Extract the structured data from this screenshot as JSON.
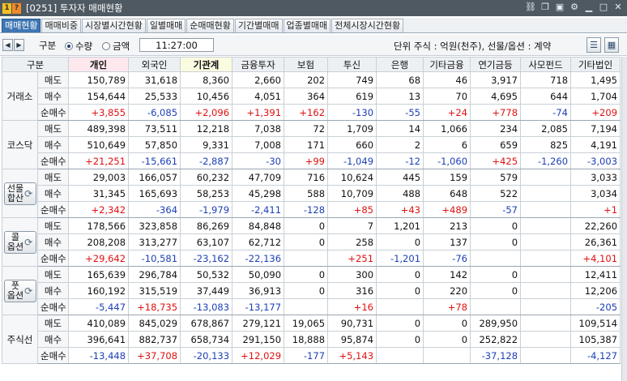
{
  "window": {
    "badge1": "1",
    "badge2": "?",
    "title": "[0251] 투자자 매매현황",
    "icons": [
      "link-icon",
      "copy-icon",
      "camera-icon",
      "gear-icon",
      "minimize-icon",
      "maximize-icon",
      "close-icon"
    ]
  },
  "tabs": [
    {
      "label": "매매현황",
      "active": true
    },
    {
      "label": "매매비중"
    },
    {
      "label": "시장별시간현황"
    },
    {
      "label": "일별매매"
    },
    {
      "label": "순매매현황"
    },
    {
      "label": "기간별매매"
    },
    {
      "label": "업종별매매"
    },
    {
      "label": "전체시장시간현황"
    }
  ],
  "controls": {
    "type_label": "구분",
    "radio_quantity": "수량",
    "radio_amount": "금액",
    "selected": "수량",
    "time": "11:27:00",
    "unit_text": "단위 주식 : 억원(천주), 선물/옵션 : 계약"
  },
  "table": {
    "headers": [
      "구분",
      "",
      "개인",
      "외국인",
      "기관계",
      "금융투자",
      "보험",
      "투신",
      "은행",
      "기타금융",
      "연기금등",
      "사모펀드",
      "기타법인"
    ],
    "groups": [
      {
        "name": "거래소",
        "button": false,
        "rows": [
          {
            "type": "매도",
            "values": [
              "150,789",
              "31,618",
              "8,360",
              "2,660",
              "202",
              "749",
              "68",
              "46",
              "3,917",
              "718",
              "1,495"
            ]
          },
          {
            "type": "매수",
            "values": [
              "154,644",
              "25,533",
              "10,456",
              "4,051",
              "364",
              "619",
              "13",
              "70",
              "4,695",
              "644",
              "1,704"
            ]
          },
          {
            "type": "순매수",
            "values": [
              "+3,855",
              "-6,085",
              "+2,096",
              "+1,391",
              "+162",
              "-130",
              "-55",
              "+24",
              "+778",
              "-74",
              "+209"
            ]
          }
        ]
      },
      {
        "name": "코스닥",
        "button": false,
        "rows": [
          {
            "type": "매도",
            "values": [
              "489,398",
              "73,511",
              "12,218",
              "7,038",
              "72",
              "1,709",
              "14",
              "1,066",
              "234",
              "2,085",
              "7,194"
            ]
          },
          {
            "type": "매수",
            "values": [
              "510,649",
              "57,850",
              "9,331",
              "7,008",
              "171",
              "660",
              "2",
              "6",
              "659",
              "825",
              "4,191"
            ]
          },
          {
            "type": "순매수",
            "values": [
              "+21,251",
              "-15,661",
              "-2,887",
              "-30",
              "+99",
              "-1,049",
              "-12",
              "-1,060",
              "+425",
              "-1,260",
              "-3,003"
            ]
          }
        ]
      },
      {
        "name": "선물\n합산",
        "button": true,
        "rows": [
          {
            "type": "매도",
            "values": [
              "29,003",
              "166,057",
              "60,232",
              "47,709",
              "716",
              "10,624",
              "445",
              "159",
              "579",
              "",
              "3,033"
            ]
          },
          {
            "type": "매수",
            "values": [
              "31,345",
              "165,693",
              "58,253",
              "45,298",
              "588",
              "10,709",
              "488",
              "648",
              "522",
              "",
              "3,034"
            ]
          },
          {
            "type": "순매수",
            "values": [
              "+2,342",
              "-364",
              "-1,979",
              "-2,411",
              "-128",
              "+85",
              "+43",
              "+489",
              "-57",
              "",
              "+1"
            ]
          }
        ]
      },
      {
        "name": "콜\n옵션",
        "button": true,
        "rows": [
          {
            "type": "매도",
            "values": [
              "178,566",
              "323,858",
              "86,269",
              "84,848",
              "0",
              "7",
              "1,201",
              "213",
              "0",
              "",
              "22,260"
            ]
          },
          {
            "type": "매수",
            "values": [
              "208,208",
              "313,277",
              "63,107",
              "62,712",
              "0",
              "258",
              "0",
              "137",
              "0",
              "",
              "26,361"
            ]
          },
          {
            "type": "순매수",
            "values": [
              "+29,642",
              "-10,581",
              "-23,162",
              "-22,136",
              "",
              "+251",
              "-1,201",
              "-76",
              "",
              "",
              "+4,101"
            ]
          }
        ]
      },
      {
        "name": "풋\n옵션",
        "button": true,
        "rows": [
          {
            "type": "매도",
            "values": [
              "165,639",
              "296,784",
              "50,532",
              "50,090",
              "0",
              "300",
              "0",
              "142",
              "0",
              "",
              "12,411"
            ]
          },
          {
            "type": "매수",
            "values": [
              "160,192",
              "315,519",
              "37,449",
              "36,913",
              "0",
              "316",
              "0",
              "220",
              "0",
              "",
              "12,206"
            ]
          },
          {
            "type": "순매수",
            "values": [
              "-5,447",
              "+18,735",
              "-13,083",
              "-13,177",
              "",
              "+16",
              "",
              "+78",
              "",
              "",
              "-205"
            ]
          }
        ]
      },
      {
        "name": "주식선",
        "button": false,
        "rows": [
          {
            "type": "매도",
            "values": [
              "410,089",
              "845,029",
              "678,867",
              "279,121",
              "19,065",
              "90,731",
              "0",
              "0",
              "289,950",
              "",
              "109,514"
            ]
          },
          {
            "type": "매수",
            "values": [
              "396,641",
              "882,737",
              "658,734",
              "291,150",
              "18,888",
              "95,874",
              "0",
              "0",
              "252,822",
              "",
              "105,387"
            ]
          },
          {
            "type": "순매수",
            "values": [
              "-13,448",
              "+37,708",
              "-20,133",
              "+12,029",
              "-177",
              "+5,143",
              "",
              "",
              "-37,128",
              "",
              "-4,127"
            ]
          }
        ]
      }
    ]
  },
  "colors": {
    "positive": "#e01010",
    "negative": "#1b3fb5",
    "active_tab": "#3e76b3",
    "titlebar": "#4e5962"
  }
}
